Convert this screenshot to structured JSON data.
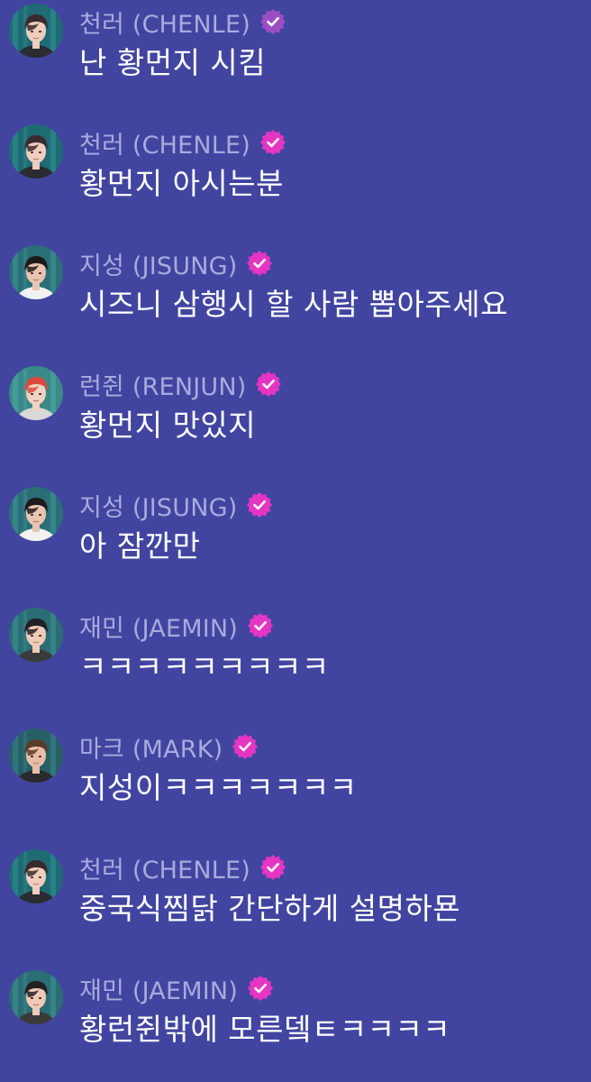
{
  "chat": {
    "messages": [
      {
        "author": "천러 (CHENLE)",
        "text": "난 황먼지 시킴",
        "avatar": "chenle-avatar",
        "verified": true,
        "badge_color": "#9c4dc4"
      },
      {
        "author": "천러 (CHENLE)",
        "text": "황먼지 아시는분",
        "avatar": "chenle-avatar",
        "verified": true,
        "badge_color": "#e535c3"
      },
      {
        "author": "지성 (JISUNG)",
        "text": "시즈니 삼행시 할 사람 뽑아주세요",
        "avatar": "jisung-avatar",
        "verified": true,
        "badge_color": "#e535c3"
      },
      {
        "author": "런쥔 (RENJUN)",
        "text": "황먼지 맛있지",
        "avatar": "renjun-avatar",
        "verified": true,
        "badge_color": "#e535c3"
      },
      {
        "author": "지성 (JISUNG)",
        "text": "아 잠깐만",
        "avatar": "jisung-avatar",
        "verified": true,
        "badge_color": "#e535c3"
      },
      {
        "author": "재민 (JAEMIN)",
        "text": "ㅋㅋㅋㅋㅋㅋㅋㅋㅋ",
        "avatar": "jaemin-avatar",
        "verified": true,
        "badge_color": "#e535c3"
      },
      {
        "author": "마크 (MARK)",
        "text": "지성이ㅋㅋㅋㅋㅋㅋㅋ",
        "avatar": "mark-avatar",
        "verified": true,
        "badge_color": "#e535c3"
      },
      {
        "author": "천러 (CHENLE)",
        "text": "중국식찜닭 간단하게 설명하묜",
        "avatar": "chenle-avatar",
        "verified": true,
        "badge_color": "#e535c3"
      },
      {
        "author": "재민 (JAEMIN)",
        "text": "황런쥔밖에 모른뎈ㅌㅋㅋㅋㅋ",
        "avatar": "jaemin-avatar",
        "verified": true,
        "badge_color": "#e535c3"
      }
    ]
  }
}
